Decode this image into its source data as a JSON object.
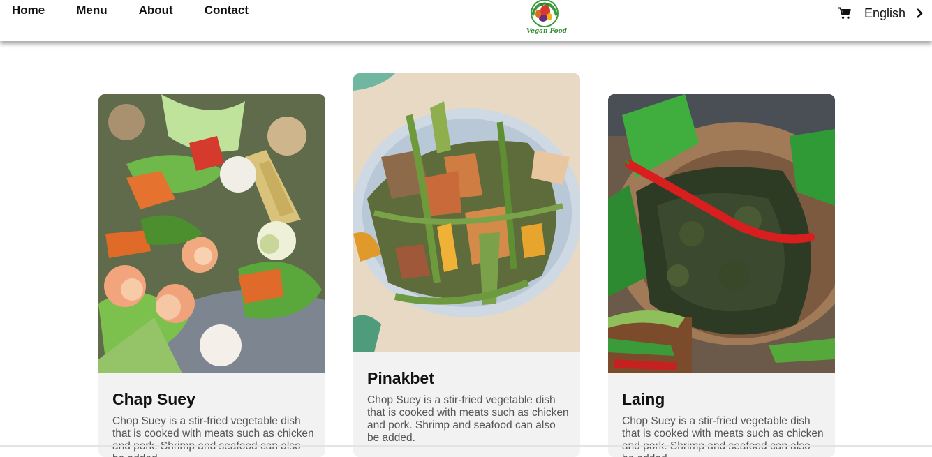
{
  "nav": {
    "links": [
      "Home",
      "Menu",
      "About",
      "Contact"
    ],
    "logo_text": "Vegan Food",
    "language": "English"
  },
  "cards": [
    {
      "title": "Chap Suey",
      "description": "Chop Suey is a stir-fried vegetable dish that is cooked with meats such as chicken and pork. Shrimp and seafood can also be added."
    },
    {
      "title": "Pinakbet",
      "description": "Chop Suey is a stir-fried vegetable dish that is cooked with meats such as chicken and pork. Shrimp and seafood can also be added."
    },
    {
      "title": "Laing",
      "description": "Chop Suey is a stir-fried vegetable dish that is cooked with meats such as chicken and pork. Shrimp and seafood can also be added."
    }
  ],
  "icons": {
    "cart": "cart-icon",
    "chevron": "chevron-right-icon"
  },
  "colors": {
    "card_bg": "#f2f2f2",
    "logo_green": "#2f8a2f"
  }
}
